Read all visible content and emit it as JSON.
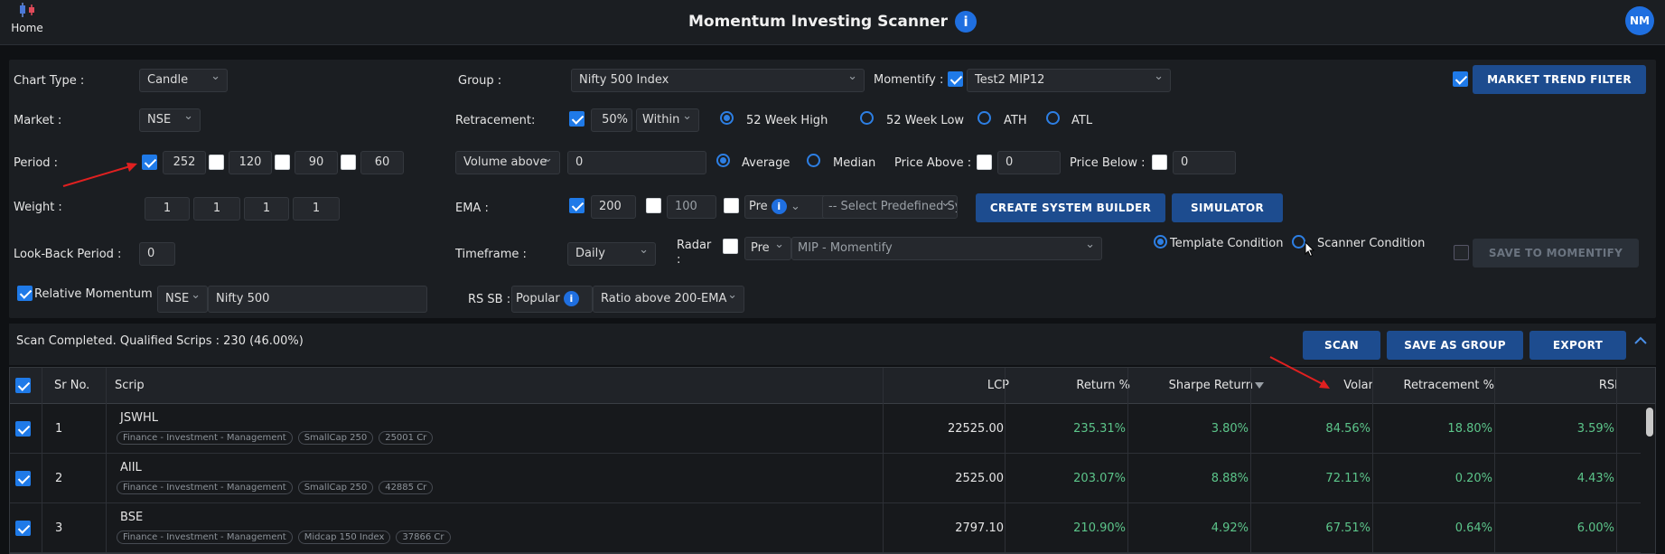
{
  "topbar": {
    "home_label": "Home",
    "title": "Momentum Investing Scanner",
    "info_symbol": "i",
    "avatar_initials": "NM"
  },
  "filters": {
    "chart_type": {
      "label": "Chart Type :",
      "value": "Candle"
    },
    "market": {
      "label": "Market :",
      "value": "NSE"
    },
    "period": {
      "label": "Period :",
      "values": [
        "252",
        "120",
        "90",
        "60"
      ],
      "checked": [
        true,
        false,
        false,
        false
      ]
    },
    "weight": {
      "label": "Weight :",
      "values": [
        "1",
        "1",
        "1",
        "1"
      ]
    },
    "lookback": {
      "label": "Look-Back Period :",
      "value": "0"
    },
    "relative_momentum": {
      "label": "Relative Momentum :",
      "checked": true,
      "exchange": "NSE",
      "index": "Nifty 500"
    },
    "group": {
      "label": "Group :",
      "value": "Nifty 500 Index"
    },
    "momentify": {
      "label": "Momentify :",
      "checked": true,
      "value": "Test2 MIP12"
    },
    "market_trend_filter": {
      "checked": true,
      "button": "MARKET TREND FILTER"
    },
    "retracement": {
      "label": "Retracement:",
      "checked": true,
      "percent": "50",
      "percent_sign": "%",
      "mode": "Within",
      "options": [
        {
          "label": "52 Week High",
          "selected": true
        },
        {
          "label": "52 Week Low",
          "selected": false
        },
        {
          "label": "ATH",
          "selected": false
        },
        {
          "label": "ATL",
          "selected": false
        }
      ]
    },
    "volume": {
      "mode": "Volume above",
      "value": "0",
      "options": [
        {
          "label": "Average",
          "selected": true
        },
        {
          "label": "Median",
          "selected": false
        }
      ],
      "price_above": {
        "label": "Price Above :",
        "checked": false,
        "value": "0"
      },
      "price_below": {
        "label": "Price Below :",
        "checked": false,
        "value": "0"
      }
    },
    "ema": {
      "label": "EMA :",
      "ema1": {
        "checked": true,
        "value": "200"
      },
      "ema2": {
        "checked": false,
        "value": "100"
      },
      "pre": {
        "checked": false,
        "label": "Pre"
      },
      "predefined_placeholder": "-- Select Predefined System --"
    },
    "buttons": {
      "create_system_builder": "CREATE SYSTEM BUILDER",
      "simulator": "SIMULATOR",
      "save_to_momentify": "SAVE TO MOMENTIFY"
    },
    "timeframe": {
      "label": "Timeframe :",
      "value": "Daily"
    },
    "radar": {
      "label_line1": "Radar",
      "label_line2": ":",
      "checked": false,
      "pre": "Pre",
      "value": "MIP - Momentify"
    },
    "condition": {
      "template": "Template Condition",
      "scanner": "Scanner Condition",
      "selected": "template"
    },
    "save_checked": false,
    "rs_sb": {
      "label": "RS SB :",
      "mode": "Popular",
      "value": "Ratio above 200-EMA"
    }
  },
  "status": {
    "text": "Scan Completed. Qualified Scrips : 230 (46.00%)",
    "buttons": {
      "scan": "SCAN",
      "save_as_group": "SAVE AS GROUP",
      "export": "EXPORT"
    },
    "collapse_icon": "^"
  },
  "table": {
    "headers": {
      "sr": "Sr No.",
      "scrip": "Scrip",
      "lcp": "LCP",
      "return": "Return %",
      "sharpe": "Sharpe Return",
      "volar": "Volar",
      "retracement": "Retracement %",
      "rsi": "RSI"
    },
    "sorted_column": "Sharpe Return",
    "rows": [
      {
        "sr": "1",
        "name": "JSWHL",
        "sector": "Finance - Investment - Management",
        "index": "SmallCap 250",
        "mcap": "25001 Cr",
        "lcp": "22525.00",
        "ret": "235.31%",
        "sharpe": "3.80%",
        "volar": "84.56%",
        "retr": "18.80%",
        "rsi": "3.59%"
      },
      {
        "sr": "2",
        "name": "AIIL",
        "sector": "Finance - Investment - Management",
        "index": "SmallCap 250",
        "mcap": "42885 Cr",
        "lcp": "2525.00",
        "ret": "203.07%",
        "sharpe": "8.88%",
        "volar": "72.11%",
        "retr": "0.20%",
        "rsi": "4.43%"
      },
      {
        "sr": "3",
        "name": "BSE",
        "sector": "Finance - Investment - Management",
        "index": "Midcap 150 Index",
        "mcap": "37866 Cr",
        "lcp": "2797.10",
        "ret": "210.90%",
        "sharpe": "4.92%",
        "volar": "67.51%",
        "retr": "0.64%",
        "rsi": "6.00%"
      }
    ]
  },
  "colors": {
    "accent": "#1f6fe0",
    "button": "#1d4c8f",
    "positive": "#5cc58a",
    "annotation": "#e02020"
  }
}
